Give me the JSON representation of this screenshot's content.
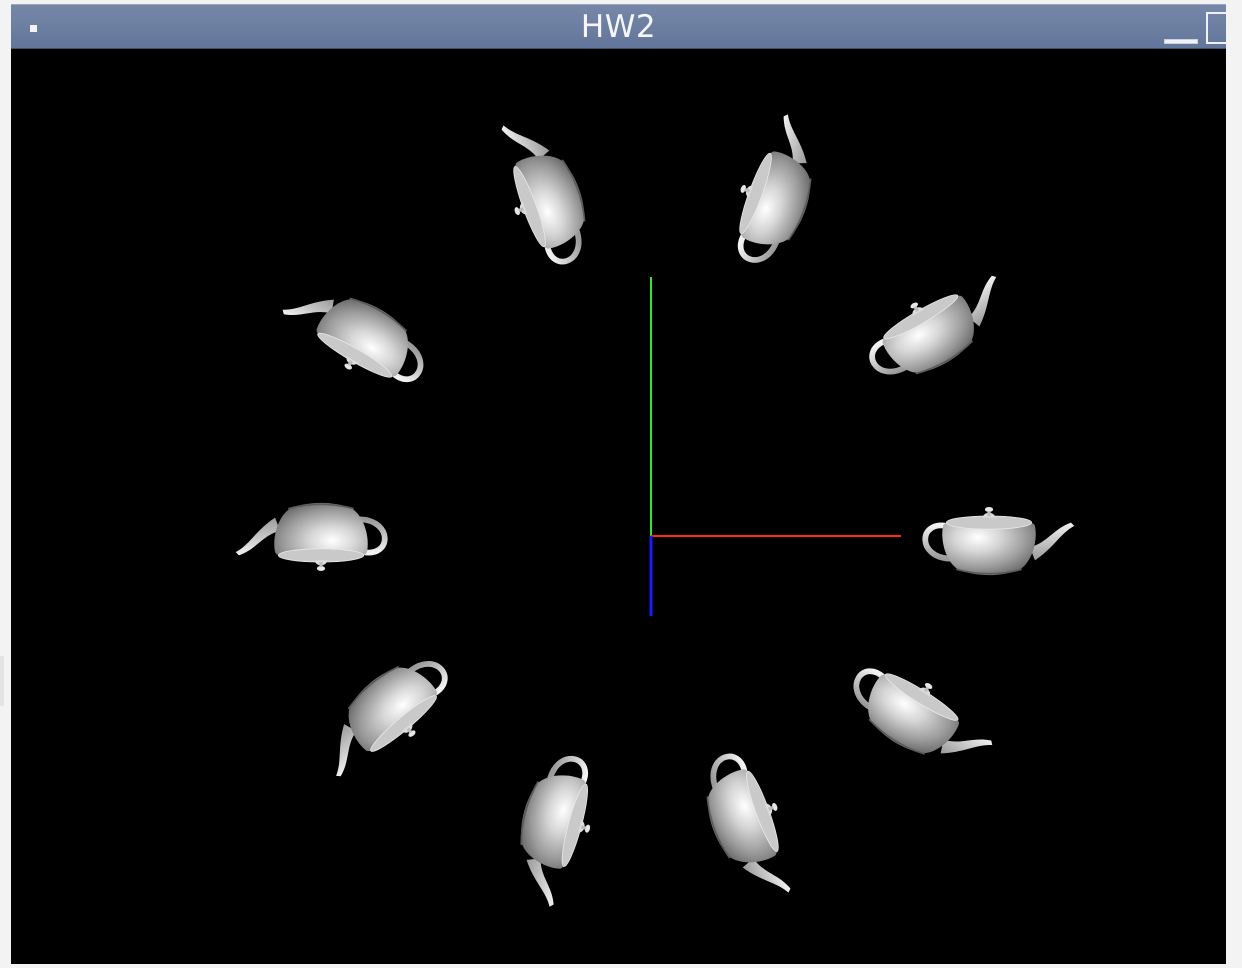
{
  "window": {
    "title": "HW2"
  },
  "scene": {
    "teapot_count": 10,
    "teapot_color": "#d2d2d2",
    "background": "#000000",
    "axes": {
      "x_color": "#ff2a00",
      "y_color": "#33e633",
      "z_color": "#1a1aff"
    }
  }
}
